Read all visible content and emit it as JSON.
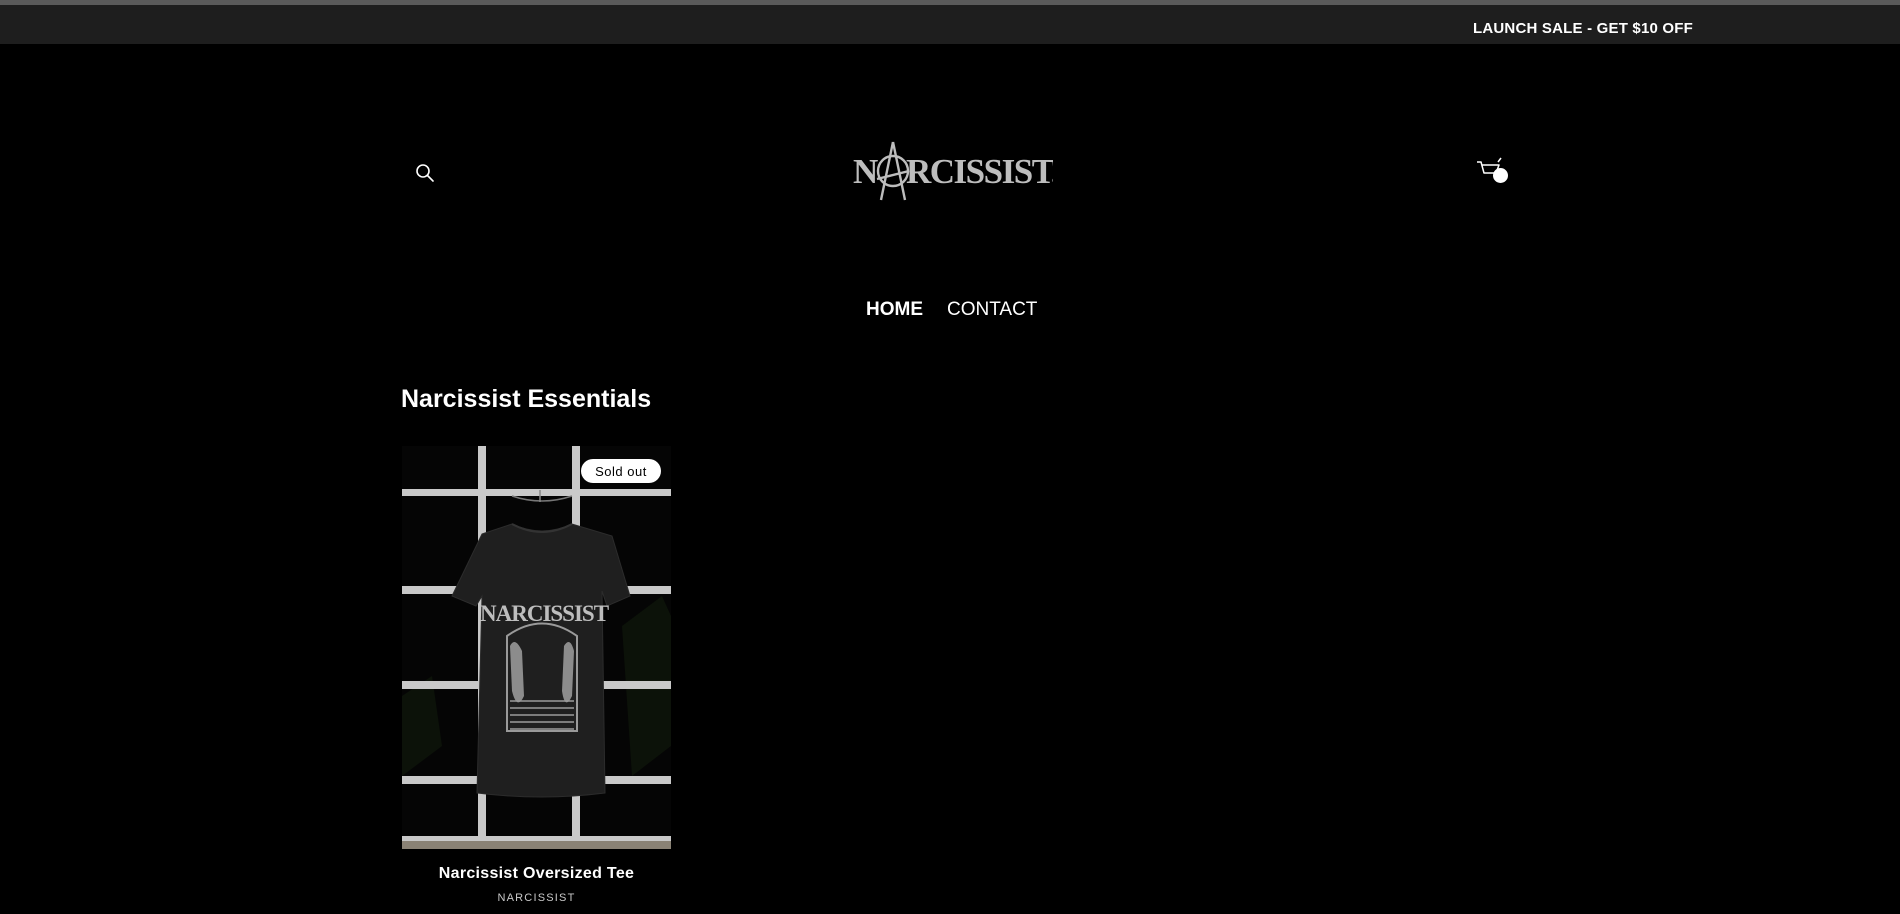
{
  "announcement": {
    "text": "LAUNCH SALE - GET $10 OFF"
  },
  "header": {
    "logo_text": "NARCISSIST",
    "search_icon": "search-icon",
    "cart_icon": "cart-icon"
  },
  "nav": {
    "items": [
      {
        "label": "HOME",
        "active": true
      },
      {
        "label": "CONTACT",
        "active": false
      }
    ]
  },
  "collection": {
    "title": "Narcissist Essentials",
    "products": [
      {
        "title": "Narcissist Oversized Tee",
        "vendor": "NARCISSIST",
        "badge": "Sold out",
        "image_logo_text": "NARCISSIST"
      }
    ]
  },
  "colors": {
    "background": "#000000",
    "announcement_bg": "#1e1e1e",
    "text": "#ffffff",
    "badge_bg": "#ffffff"
  }
}
